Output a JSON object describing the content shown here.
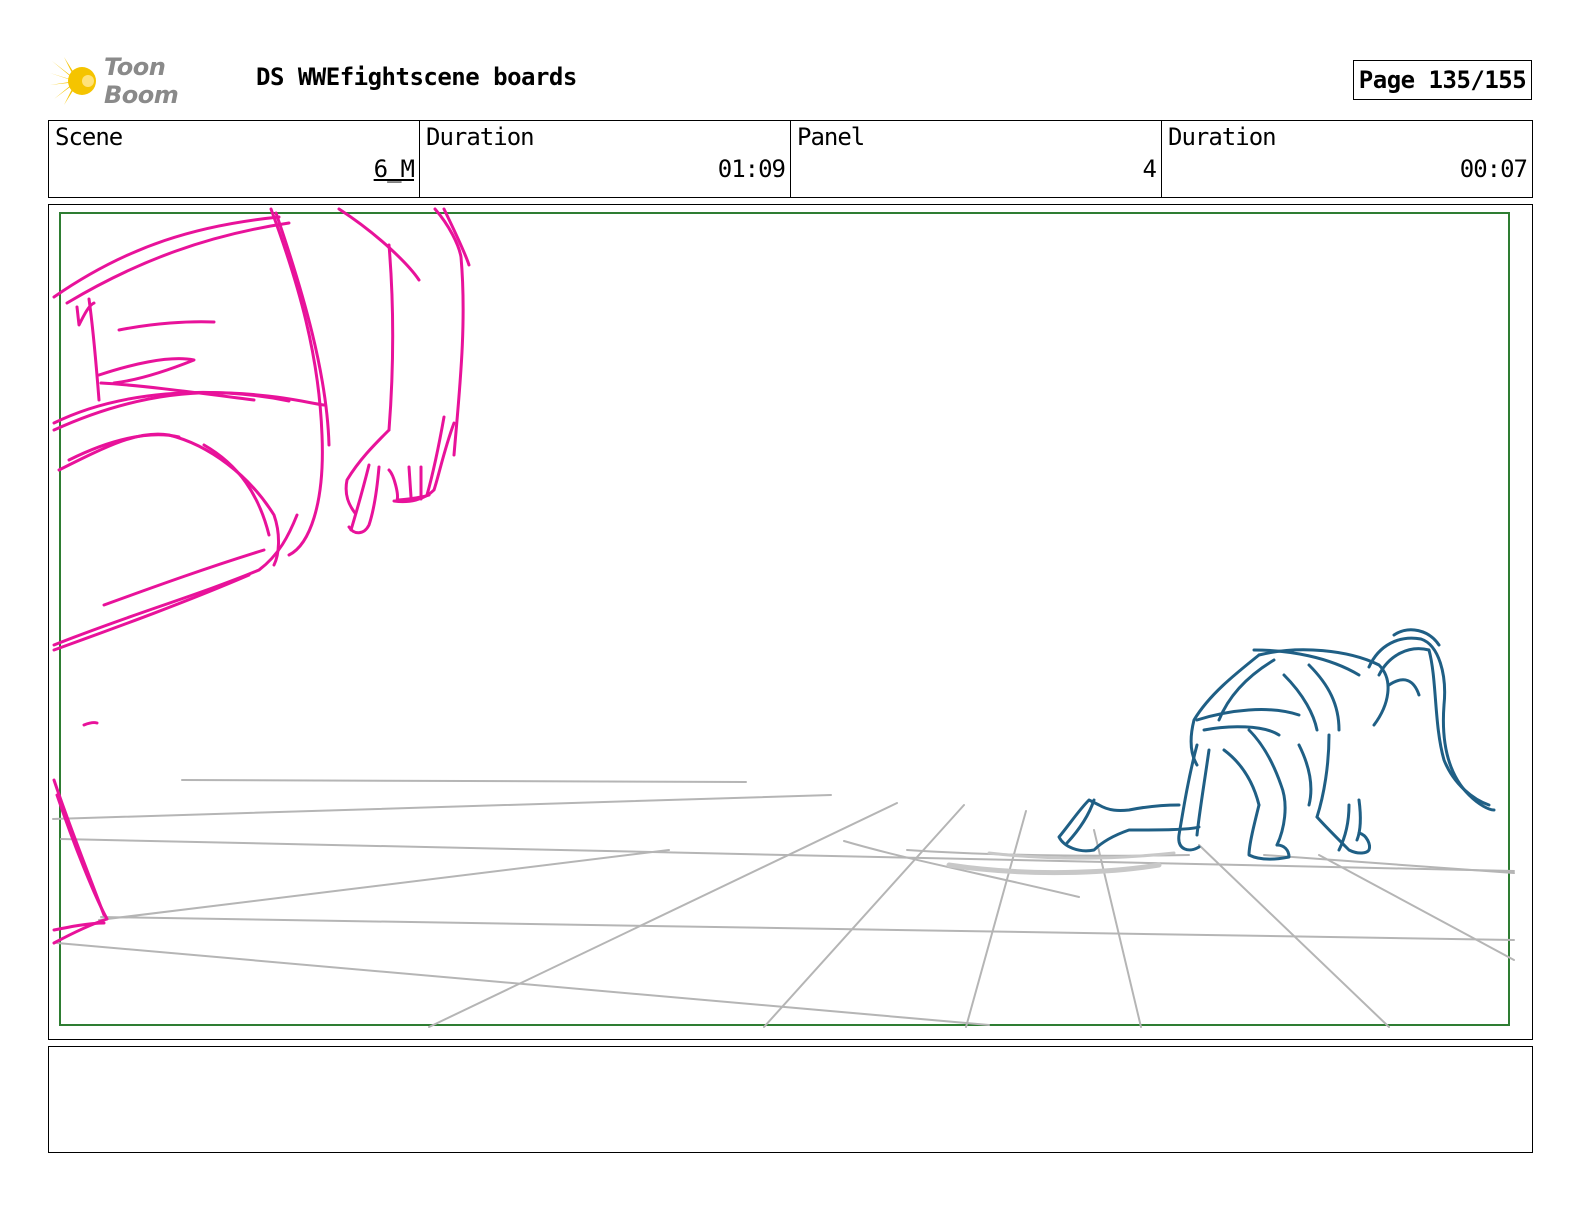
{
  "header": {
    "logo_text": "Toon Boom",
    "title": "DS WWEfightscene boards",
    "page_label": "Page 135/155"
  },
  "info": {
    "scene_label": "Scene",
    "scene_value": "6_M",
    "scene_duration_label": "Duration",
    "scene_duration_value": "01:09",
    "panel_label": "Panel",
    "panel_value": "4",
    "panel_duration_label": "Duration",
    "panel_duration_value": "00:07"
  },
  "colors": {
    "safe_frame": "#2e7d32",
    "character_magenta": "#e8129a",
    "character_blue": "#1f5f85",
    "floor_grid": "#b5b5b5",
    "logo_star": "#f5c400"
  },
  "caption": {
    "text": ""
  }
}
